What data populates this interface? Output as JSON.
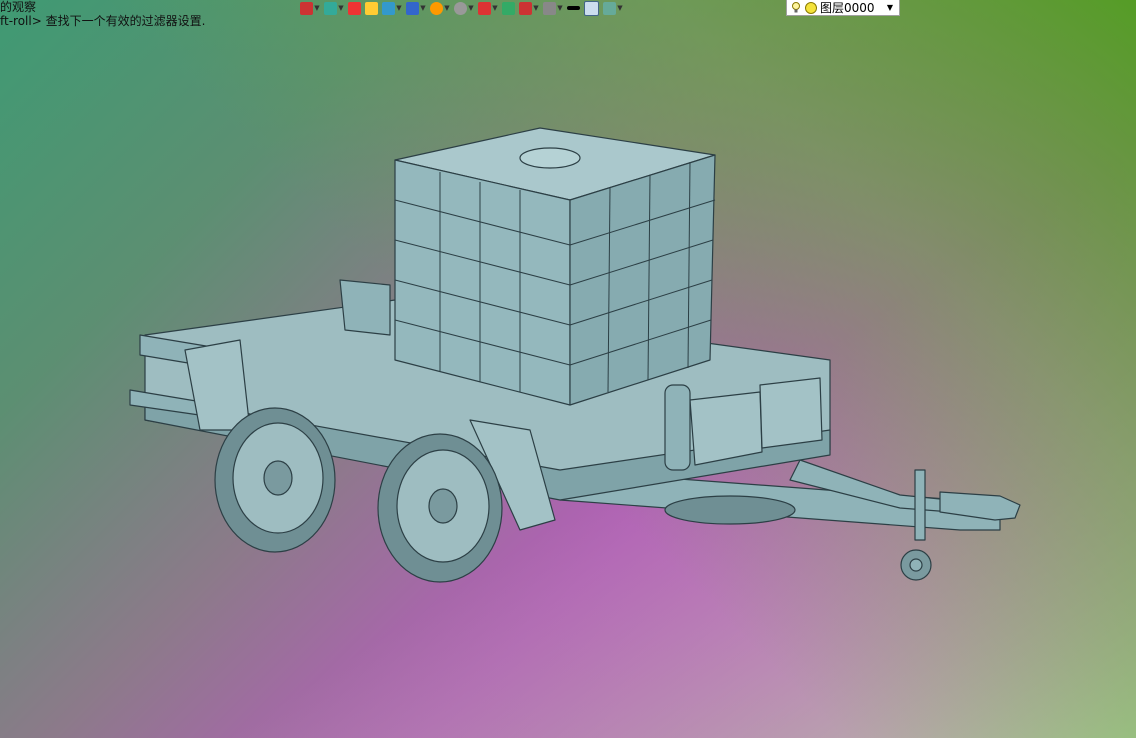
{
  "command_line": {
    "line1": "的观察",
    "line2": "ft-roll> 查找下一个有效的过滤器设置."
  },
  "toolbar": {
    "icons": [
      "view-orient-icon",
      "light-icon",
      "pencil-icon",
      "box-yellow-icon",
      "cube-icon",
      "cube-stack-icon",
      "orange-wheel-icon",
      "zoom-icon",
      "axis-icon",
      "box-green-icon",
      "book-icon",
      "monitor-icon",
      "line-icon",
      "rect-icon",
      "layers-icon"
    ],
    "colors": [
      "#c33",
      "#3a9",
      "#e33",
      "#fc3",
      "#39c",
      "#36c",
      "#f90",
      "#999",
      "#d33",
      "#3a6",
      "#c33",
      "#888",
      "#000",
      "#cde",
      "#6a9"
    ]
  },
  "layer": {
    "name": "图层0000"
  },
  "viewport": {
    "model": "trailer-with-ibc-tank",
    "colors": {
      "body": "#8fb3b8",
      "edge": "#2c3f45",
      "tire": "#6f8f94"
    }
  }
}
